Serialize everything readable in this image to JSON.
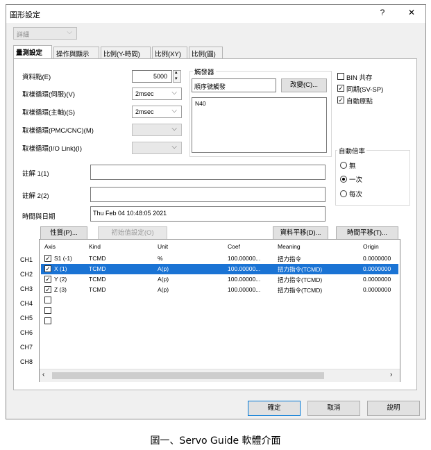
{
  "window": {
    "title": "圖形設定",
    "help": "?",
    "close": "✕"
  },
  "mode_combo": {
    "value": "詳細"
  },
  "tabs": [
    {
      "label": "量測設定",
      "active": true
    },
    {
      "label": "操作與顯示"
    },
    {
      "label": "比例(Y-時間)"
    },
    {
      "label": "比例(XY)"
    },
    {
      "label": "比例(圓)"
    }
  ],
  "form": {
    "data_points": {
      "label": "資料點(E)",
      "value": "5000"
    },
    "sampling_servo": {
      "label": "取樣循環(伺服)(V)",
      "value": "2msec"
    },
    "sampling_spindle": {
      "label": "取樣循環(主軸)(S)",
      "value": "2msec"
    },
    "sampling_pmc": {
      "label": "取樣循環(PMC/CNC)(M)",
      "value": ""
    },
    "sampling_io": {
      "label": "取樣循環(I/O Link)(I)",
      "value": ""
    },
    "comment1": {
      "label": "註解 1(1)",
      "value": ""
    },
    "comment2": {
      "label": "註解 2(2)",
      "value": ""
    },
    "datetime": {
      "label": "時間與日期",
      "value": "Thu Feb 04 10:48:05 2021"
    }
  },
  "trigger": {
    "group_label": "觸發器",
    "mode_value": "順序號觸發",
    "change_button": "改變(C)...",
    "program_value": "N40"
  },
  "options": {
    "bin_share": {
      "label": "BIN 共存",
      "checked": false
    },
    "sync": {
      "label": "同期(SV-SP)",
      "checked": true
    },
    "auto_origin": {
      "label": "自動原點",
      "checked": true
    }
  },
  "auto_scale": {
    "group_label": "自動倍率",
    "options": [
      {
        "label": "無",
        "selected": false
      },
      {
        "label": "一次",
        "selected": true
      },
      {
        "label": "每次",
        "selected": false
      }
    ]
  },
  "buttons": {
    "properties": "性質(P)...",
    "init_settings": "初始值設定(O)",
    "data_shift": "資料平移(D)...",
    "time_shift": "時間平移(T)..."
  },
  "channels": [
    "CH1",
    "CH2",
    "CH3",
    "CH4",
    "CH5",
    "CH6",
    "CH7",
    "CH8"
  ],
  "table": {
    "columns": [
      "Axis",
      "Kind",
      "Unit",
      "Coef",
      "Meaning",
      "Origin"
    ],
    "rows": [
      {
        "axis": "S1 (-1)",
        "kind": "TCMD",
        "unit": "%",
        "coef": "100.00000...",
        "meaning": "扭力指令",
        "origin": "0.0000000",
        "checked": true,
        "selected": false
      },
      {
        "axis": "X (1)",
        "kind": "TCMD",
        "unit": "A(p)",
        "coef": "100.00000...",
        "meaning": "扭力指令(TCMD)",
        "origin": "0.0000000",
        "checked": true,
        "selected": true
      },
      {
        "axis": "Y (2)",
        "kind": "TCMD",
        "unit": "A(p)",
        "coef": "100.00000...",
        "meaning": "扭力指令(TCMD)",
        "origin": "0.0000000",
        "checked": true,
        "selected": false
      },
      {
        "axis": "Z (3)",
        "kind": "TCMD",
        "unit": "A(p)",
        "coef": "100.00000...",
        "meaning": "扭力指令(TCMD)",
        "origin": "0.0000000",
        "checked": true,
        "selected": false
      },
      {
        "axis": "",
        "checked": false
      },
      {
        "axis": "",
        "checked": false
      },
      {
        "axis": "",
        "checked": false
      }
    ]
  },
  "footer": {
    "ok": "確定",
    "cancel": "取消",
    "help": "說明"
  },
  "caption": "圖一、Servo Guide 軟體介面"
}
